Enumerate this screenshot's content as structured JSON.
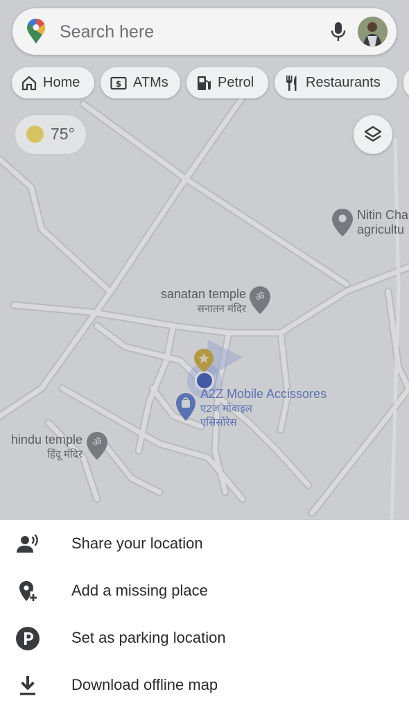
{
  "search": {
    "placeholder": "Search here",
    "pin_icon": "google-maps-pin-icon",
    "mic_icon": "microphone-icon",
    "avatar_icon": "profile-avatar"
  },
  "chips": [
    {
      "label": "Home",
      "icon": "home-icon"
    },
    {
      "label": "ATMs",
      "icon": "atm-icon"
    },
    {
      "label": "Petrol",
      "icon": "fuel-pump-icon"
    },
    {
      "label": "Restaurants",
      "icon": "fork-knife-icon"
    }
  ],
  "weather": {
    "temperature": "75°",
    "icon": "sun-icon"
  },
  "layers_button": {
    "icon": "layers-icon"
  },
  "map_labels": {
    "nitin_name": "Nitin Cha",
    "nitin_sub": "agricultu",
    "sanatan_name": "sanatan temple",
    "sanatan_sub": "सनातन मंदिर",
    "a2z_name": "A2Z Mobile Accissores",
    "a2z_sub1": "ए2ज मोबाइल",
    "a2z_sub2": "एसिसोरेस",
    "hindu_name": "hindu temple",
    "hindu_sub": "हिंदू मंदिर"
  },
  "menu": [
    {
      "label": "Share your location",
      "icon": "share-location-icon"
    },
    {
      "label": "Add a missing place",
      "icon": "add-place-icon"
    },
    {
      "label": "Set as parking location",
      "icon": "parking-icon"
    },
    {
      "label": "Download offline map",
      "icon": "download-icon"
    }
  ],
  "colors": {
    "map_background": "#e6e7e9",
    "road": "#f7f7f8",
    "location_dot": "#3d5bb5",
    "poi_pin": "#7d8086",
    "star_pin": "#c9a83c",
    "shopping_pin": "#5a78c6"
  }
}
